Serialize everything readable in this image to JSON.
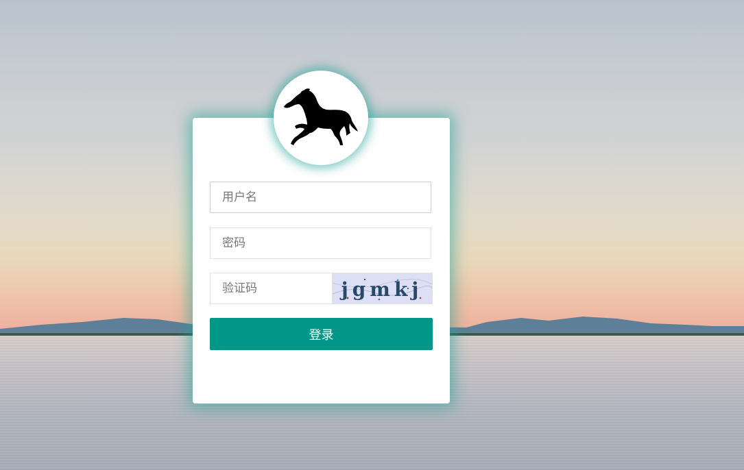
{
  "login_form": {
    "username_placeholder": "用户名",
    "password_placeholder": "密码",
    "captcha_placeholder": "验证码",
    "captcha_text": "jgmkj",
    "submit_label": "登录"
  },
  "logo": {
    "icon": "horse-icon"
  },
  "theme": {
    "accent": "#009688",
    "glow": "#1ea096",
    "card_bg": "#ffffff"
  }
}
